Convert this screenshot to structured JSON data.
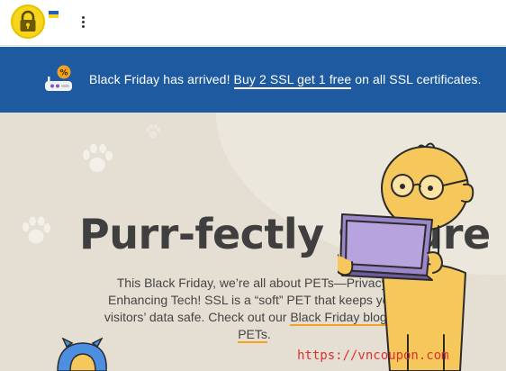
{
  "header": {
    "logo_icon": "padlock-icon",
    "flag_icon": "ukraine-flag-icon",
    "menu_icon": "kebab-menu-icon"
  },
  "banner": {
    "icon": "discount-router-icon",
    "text_before": "Black Friday has arrived! ",
    "link_label": "Buy 2 SSL get 1 free",
    "text_after": " on all SSL certificates.",
    "background": "#1e5aa0"
  },
  "hero": {
    "title": "Purr-fectly secure",
    "copy_main": "This Black Friday, we’re all about PETs—Privacy-Enhancing Tech! SSL is a “soft” PET that keeps your visitors’ data safe. Check out our ",
    "blog_link": "Black Friday blog on PETs",
    "copy_end": ".",
    "background": "#e5dfd3",
    "accent": "#f4a21e"
  },
  "watermark": "https://vncoupon.com"
}
